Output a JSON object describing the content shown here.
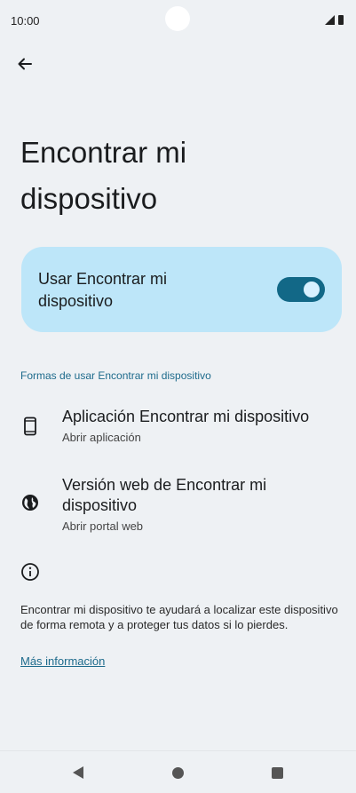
{
  "status_bar": {
    "time": "10:00"
  },
  "page": {
    "title": "Encontrar mi dispositivo"
  },
  "main_toggle": {
    "label": "Usar Encontrar mi dispositivo",
    "enabled": true,
    "accent": "#126887",
    "card_color": "#bde6f9"
  },
  "section": {
    "header": "Formas de usar Encontrar mi dispositivo"
  },
  "options": [
    {
      "title": "Aplicación Encontrar mi dispositivo",
      "subtitle": "Abrir aplicación",
      "icon": "phone-icon"
    },
    {
      "title": "Versión web de Encontrar mi dispositivo",
      "subtitle": "Abrir portal web",
      "icon": "globe-icon"
    }
  ],
  "info": {
    "icon": "info-icon",
    "text": "Encontrar mi dispositivo te ayudará a localizar este dispositivo de forma remota y a proteger tus datos si lo pierdes.",
    "link": "Más información"
  },
  "nav": {
    "icons": [
      "nav-back-icon",
      "nav-home-icon",
      "nav-recents-icon"
    ]
  }
}
